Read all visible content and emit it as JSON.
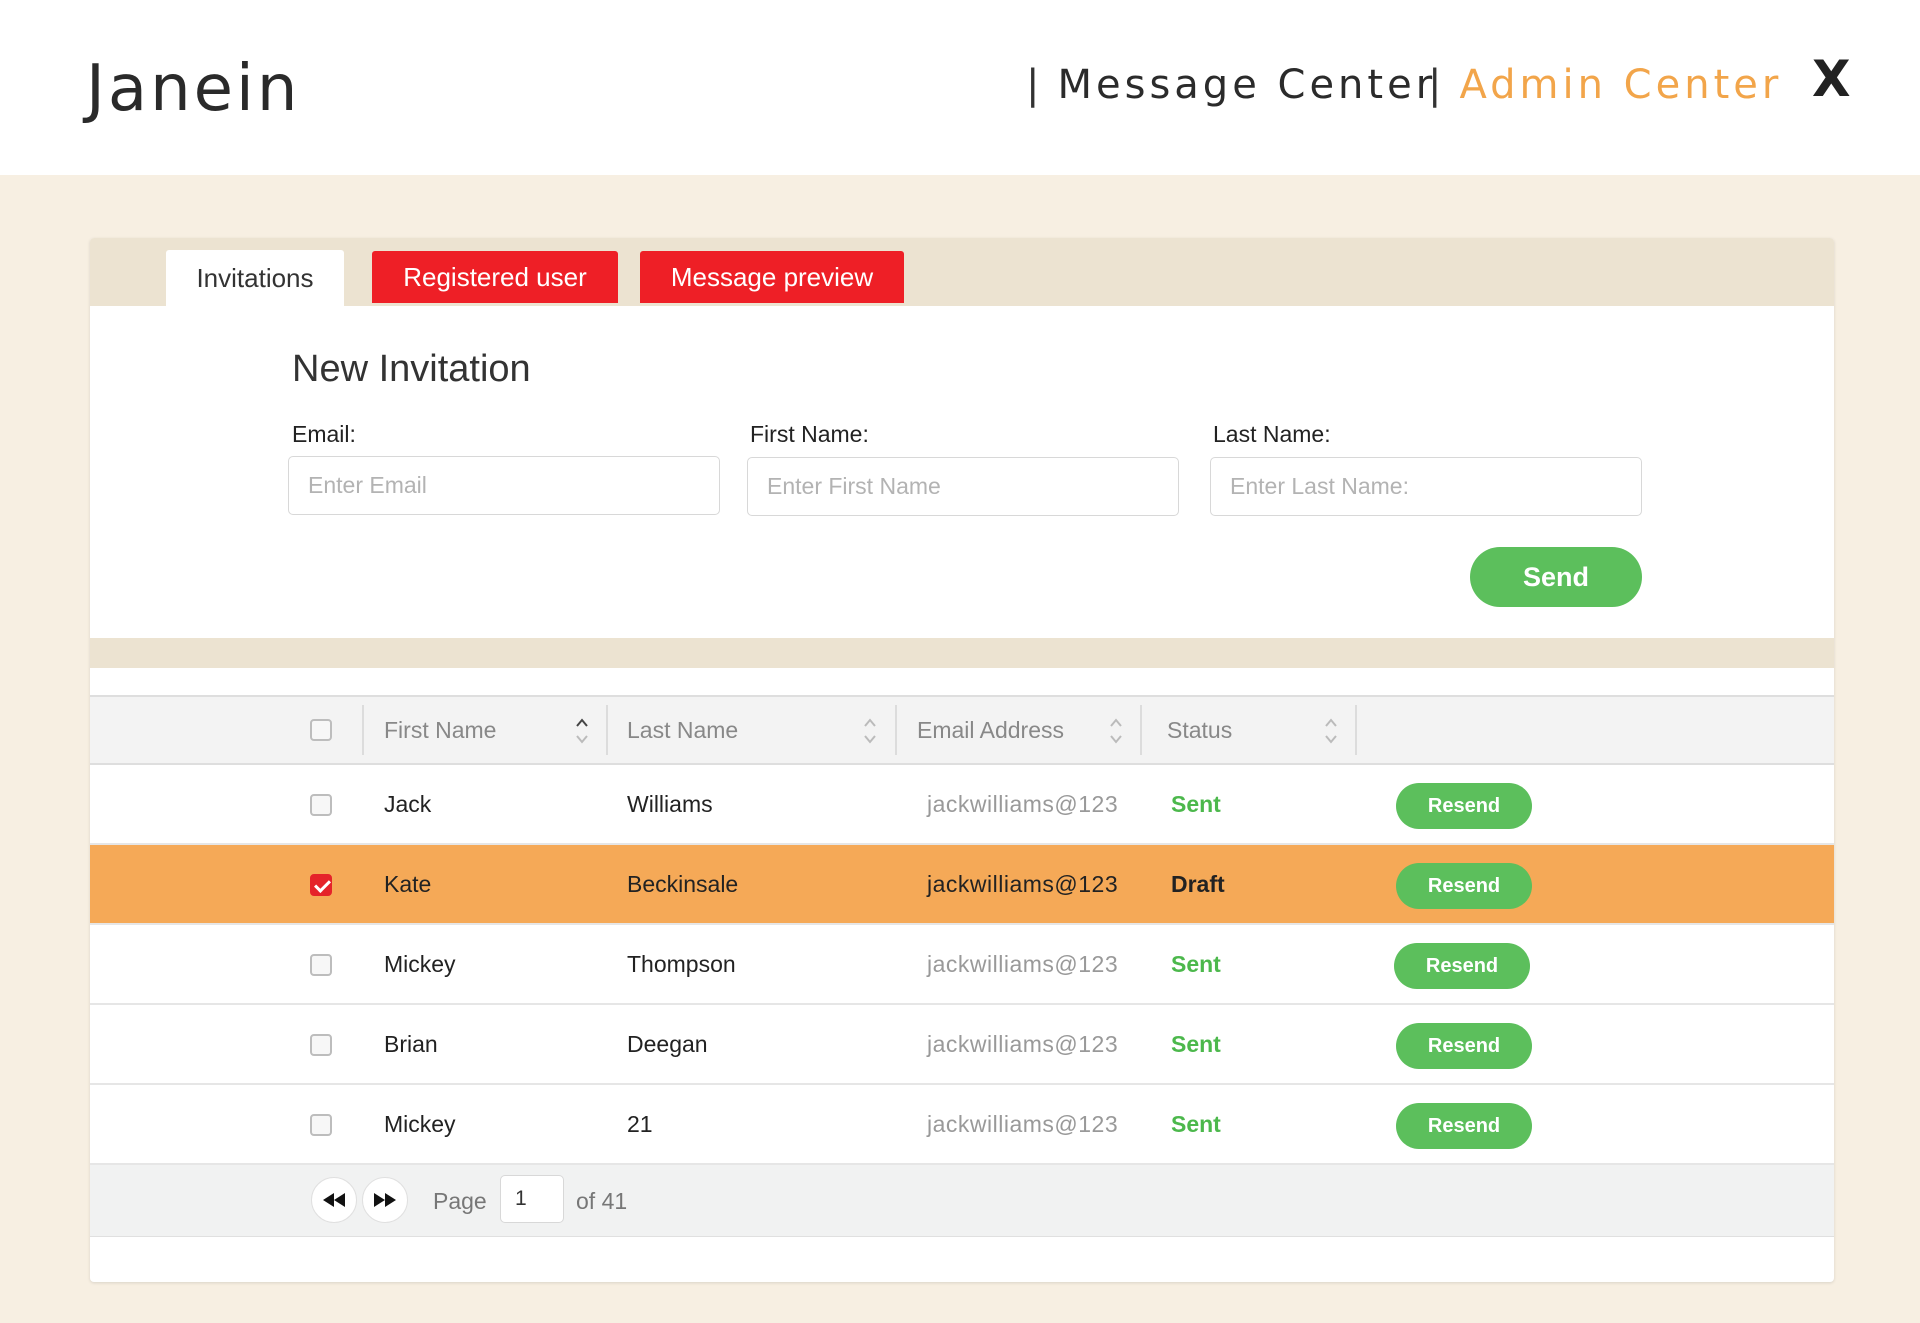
{
  "header": {
    "logo": "Janein",
    "nav": [
      {
        "label": "Message Center",
        "separator": "|"
      },
      {
        "label": "Admin Center",
        "separator": "|"
      }
    ],
    "close_label": "X",
    "active_nav_color": "#f2a54a"
  },
  "tabs": [
    {
      "label": "Invitations",
      "active": true
    },
    {
      "label": "Registered user",
      "active": false
    },
    {
      "label": "Message preview",
      "active": false
    }
  ],
  "form": {
    "title": "New Invitation",
    "email": {
      "label": "Email:",
      "placeholder": "Enter Email",
      "value": ""
    },
    "first_name": {
      "label": "First Name:",
      "placeholder": "Enter First Name",
      "value": ""
    },
    "last_name": {
      "label": "Last Name:",
      "placeholder": "Enter Last Name:",
      "value": ""
    },
    "send_label": "Send"
  },
  "table": {
    "columns": [
      "First Name",
      "Last Name",
      "Email Address",
      "Status"
    ],
    "rows": [
      {
        "first": "Jack",
        "last": "Williams",
        "email": "jackwilliams@123",
        "status": "Sent",
        "checked": false,
        "action": "Resend"
      },
      {
        "first": "Kate",
        "last": "Beckinsale",
        "email": "jackwilliams@123",
        "status": "Draft",
        "checked": true,
        "action": "Resend"
      },
      {
        "first": "Mickey",
        "last": "Thompson",
        "email": "jackwilliams@123",
        "status": "Sent",
        "checked": false,
        "action": "Resend"
      },
      {
        "first": "Brian",
        "last": "Deegan",
        "email": "jackwilliams@123",
        "status": "Sent",
        "checked": false,
        "action": "Resend"
      },
      {
        "first": "Mickey",
        "last": "21",
        "email": "jackwilliams@123",
        "status": "Sent",
        "checked": false,
        "action": "Resend"
      }
    ]
  },
  "pagination": {
    "page_label": "Page",
    "current_page": "1",
    "of_label": "of 41"
  },
  "colors": {
    "tab_red": "#ee1f26",
    "accent_orange": "#f5a957",
    "green": "#5cbf5c",
    "background": "#f7efe2"
  }
}
